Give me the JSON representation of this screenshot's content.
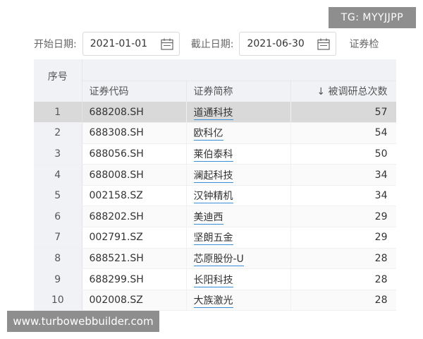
{
  "overlay_badge": "TG: MYYJJPP",
  "filter": {
    "start_label": "开始日期:",
    "start_value": "2021-01-01",
    "end_label": "截止日期:",
    "end_value": "2021-06-30",
    "truncated_label": "证券检"
  },
  "table": {
    "headers": {
      "index": "序号",
      "code": "证券代码",
      "name": "证券简称",
      "count": "↓ 被调研总次数"
    },
    "selected_row": 1,
    "rows": [
      {
        "idx": "1",
        "code": "688208.SH",
        "name": "道通科技",
        "count": "57"
      },
      {
        "idx": "2",
        "code": "688308.SH",
        "name": "欧科亿",
        "count": "54"
      },
      {
        "idx": "3",
        "code": "688056.SH",
        "name": "莱伯泰科",
        "count": "50"
      },
      {
        "idx": "4",
        "code": "688008.SH",
        "name": "澜起科技",
        "count": "34"
      },
      {
        "idx": "5",
        "code": "002158.SZ",
        "name": "汉钟精机",
        "count": "34"
      },
      {
        "idx": "6",
        "code": "688202.SH",
        "name": "美迪西",
        "count": "29"
      },
      {
        "idx": "7",
        "code": "002791.SZ",
        "name": "坚朗五金",
        "count": "29"
      },
      {
        "idx": "8",
        "code": "688521.SH",
        "name": "芯原股份-U",
        "count": "28"
      },
      {
        "idx": "9",
        "code": "688299.SH",
        "name": "长阳科技",
        "count": "28"
      },
      {
        "idx": "10",
        "code": "002008.SZ",
        "name": "大族激光",
        "count": "28"
      }
    ]
  },
  "watermark": "www.turbowebbuilder.com"
}
